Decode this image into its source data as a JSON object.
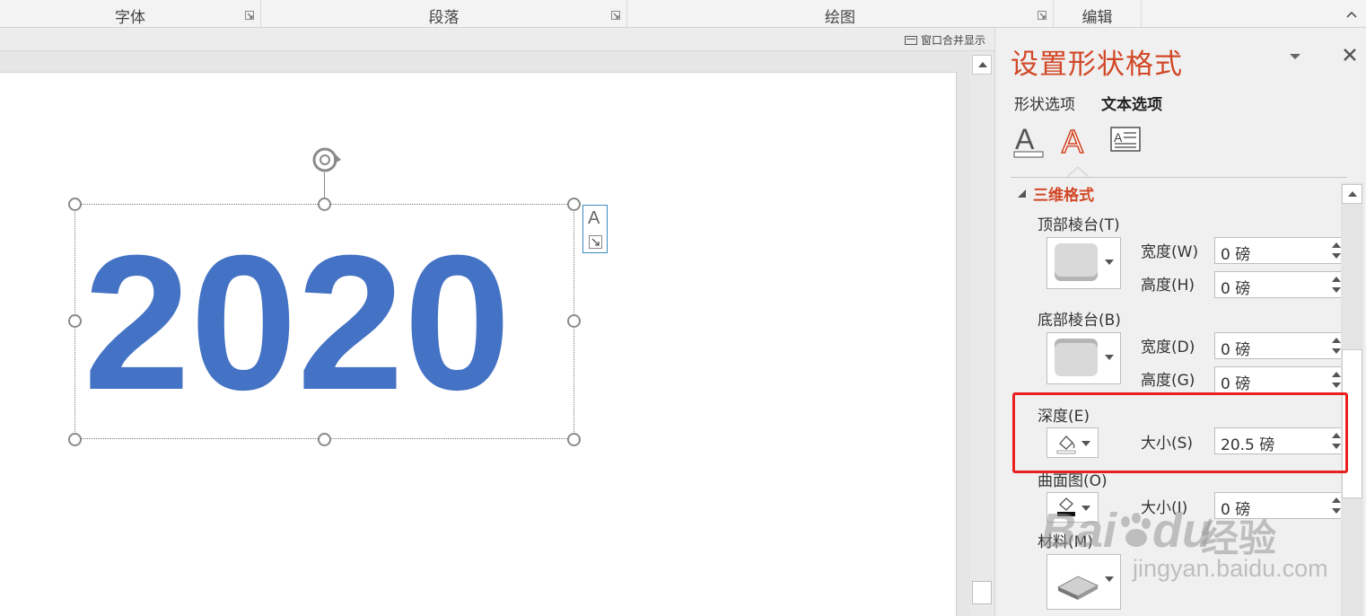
{
  "ribbon": {
    "groups": [
      {
        "label": "字体"
      },
      {
        "label": "段落"
      },
      {
        "label": "绘图"
      },
      {
        "label": "编辑"
      }
    ]
  },
  "workspace": {
    "merge_window_label": "窗口合并显示",
    "slide_text": "2020"
  },
  "pane": {
    "title": "设置形状格式",
    "tabs": [
      {
        "label": "形状选项",
        "active": false
      },
      {
        "label": "文本选项",
        "active": true
      }
    ],
    "icons": [
      "text-fill-icon",
      "text-effects-icon",
      "textbox-icon"
    ],
    "section_title": "三维格式",
    "top_bevel": {
      "label": "顶部棱台(T)",
      "width_label": "宽度(W)",
      "width_value": "0 磅",
      "height_label": "高度(H)",
      "height_value": "0 磅"
    },
    "bottom_bevel": {
      "label": "底部棱台(B)",
      "width_label": "宽度(D)",
      "width_value": "0 磅",
      "height_label": "高度(G)",
      "height_value": "0 磅"
    },
    "depth": {
      "label": "深度(E)",
      "size_label": "大小(S)",
      "size_value": "20.5 磅"
    },
    "contour": {
      "label": "曲面图(O)",
      "size_label": "大小(I)",
      "size_value": "0 磅"
    },
    "material": {
      "label": "材料(M)"
    }
  },
  "colors": {
    "accent": "#d24726",
    "slide_text": "#4472c4",
    "highlight": "#e8201f"
  },
  "watermark": {
    "brand": "Bai",
    "brand2": "du",
    "brand_cn": "经验",
    "url": "jingyan.baidu.com"
  }
}
